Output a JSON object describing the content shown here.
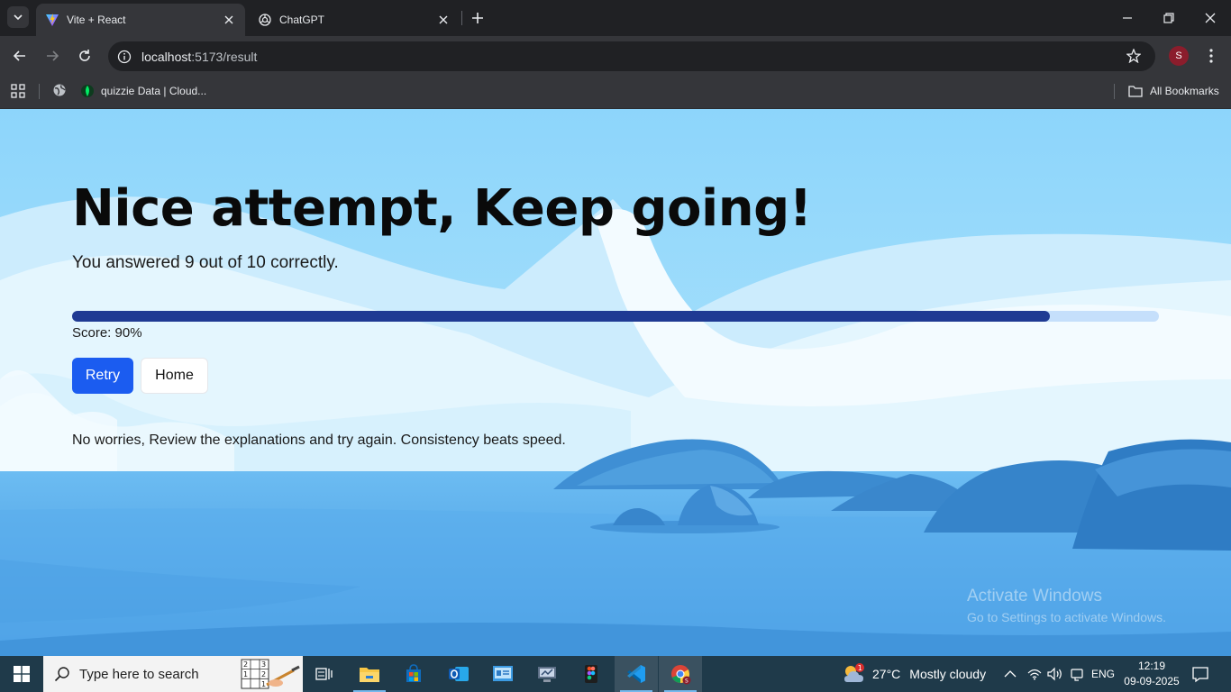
{
  "browser": {
    "tabs": [
      {
        "title": "Vite + React",
        "active": true,
        "icon": "vite-icon"
      },
      {
        "title": "ChatGPT",
        "active": false,
        "icon": "chatgpt-icon"
      }
    ],
    "address": {
      "host": "localhost",
      "path": ":5173/result"
    },
    "profile_initial": "S",
    "bookmarks": [
      {
        "label": "quizzie Data | Cloud...",
        "icon": "mongodb-leaf-icon"
      }
    ],
    "all_bookmarks_label": "All Bookmarks"
  },
  "result": {
    "heading": "Nice attempt, Keep going!",
    "summary": "You answered 9 out of 10 correctly.",
    "progress_percent": 90,
    "score_label": "Score: 90%",
    "retry_label": "Retry",
    "home_label": "Home",
    "advice": "No worries, Review the explanations and try again. Consistency beats speed.",
    "colors": {
      "progress_fill": "#1f3a93",
      "progress_track": "#c5dffb",
      "retry_bg": "#1b5cf0"
    }
  },
  "watermark": {
    "line1": "Activate Windows",
    "line2": "Go to Settings to activate Windows."
  },
  "taskbar": {
    "search_placeholder": "Type here to search",
    "apps": [
      "task-view-icon",
      "file-explorer-icon",
      "microsoft-store-icon",
      "outlook-icon",
      "control-panel-icon",
      "remote-desktop-icon",
      "figma-icon",
      "vscode-icon",
      "chrome-icon"
    ],
    "weather_badge": "1",
    "temperature": "27°C",
    "weather": "Mostly cloudy",
    "language": "ENG",
    "time": "12:19",
    "date": "09-09-2025"
  }
}
